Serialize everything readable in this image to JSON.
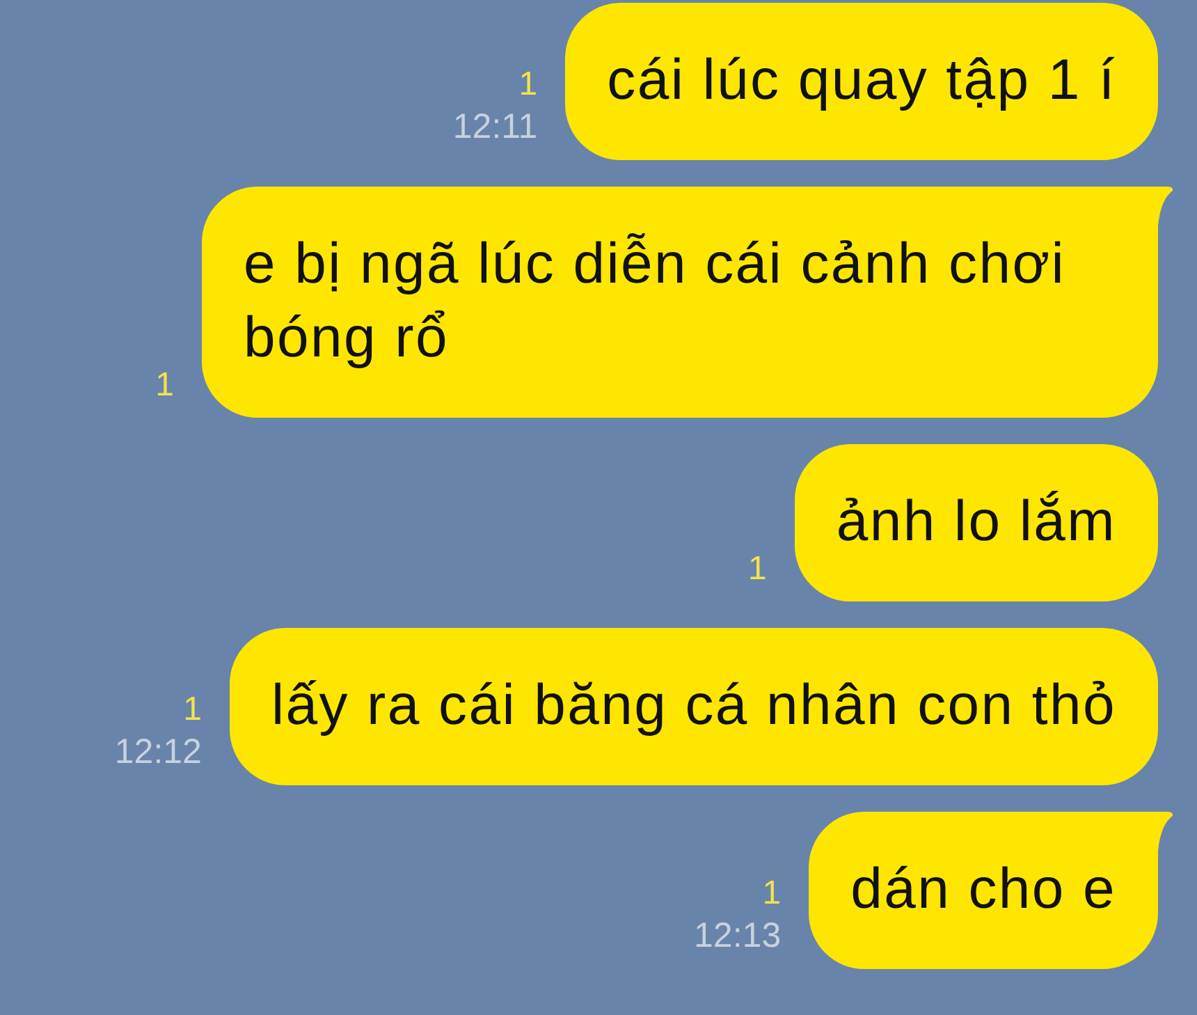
{
  "messages": [
    {
      "text": "cái lúc quay tập 1 í",
      "read_count": "1",
      "time": "12:11",
      "tail": false
    },
    {
      "text": "e bị ngã lúc diễn cái cảnh chơi bóng rổ",
      "read_count": "1",
      "tail": true
    },
    {
      "text": "ảnh lo lắm",
      "read_count": "1",
      "tail": false
    },
    {
      "text": "lấy ra cái băng cá nhân con thỏ",
      "read_count": "1",
      "time": "12:12",
      "tail": false
    },
    {
      "text": "dán cho e",
      "read_count": "1",
      "time": "12:13",
      "tail": true
    }
  ]
}
